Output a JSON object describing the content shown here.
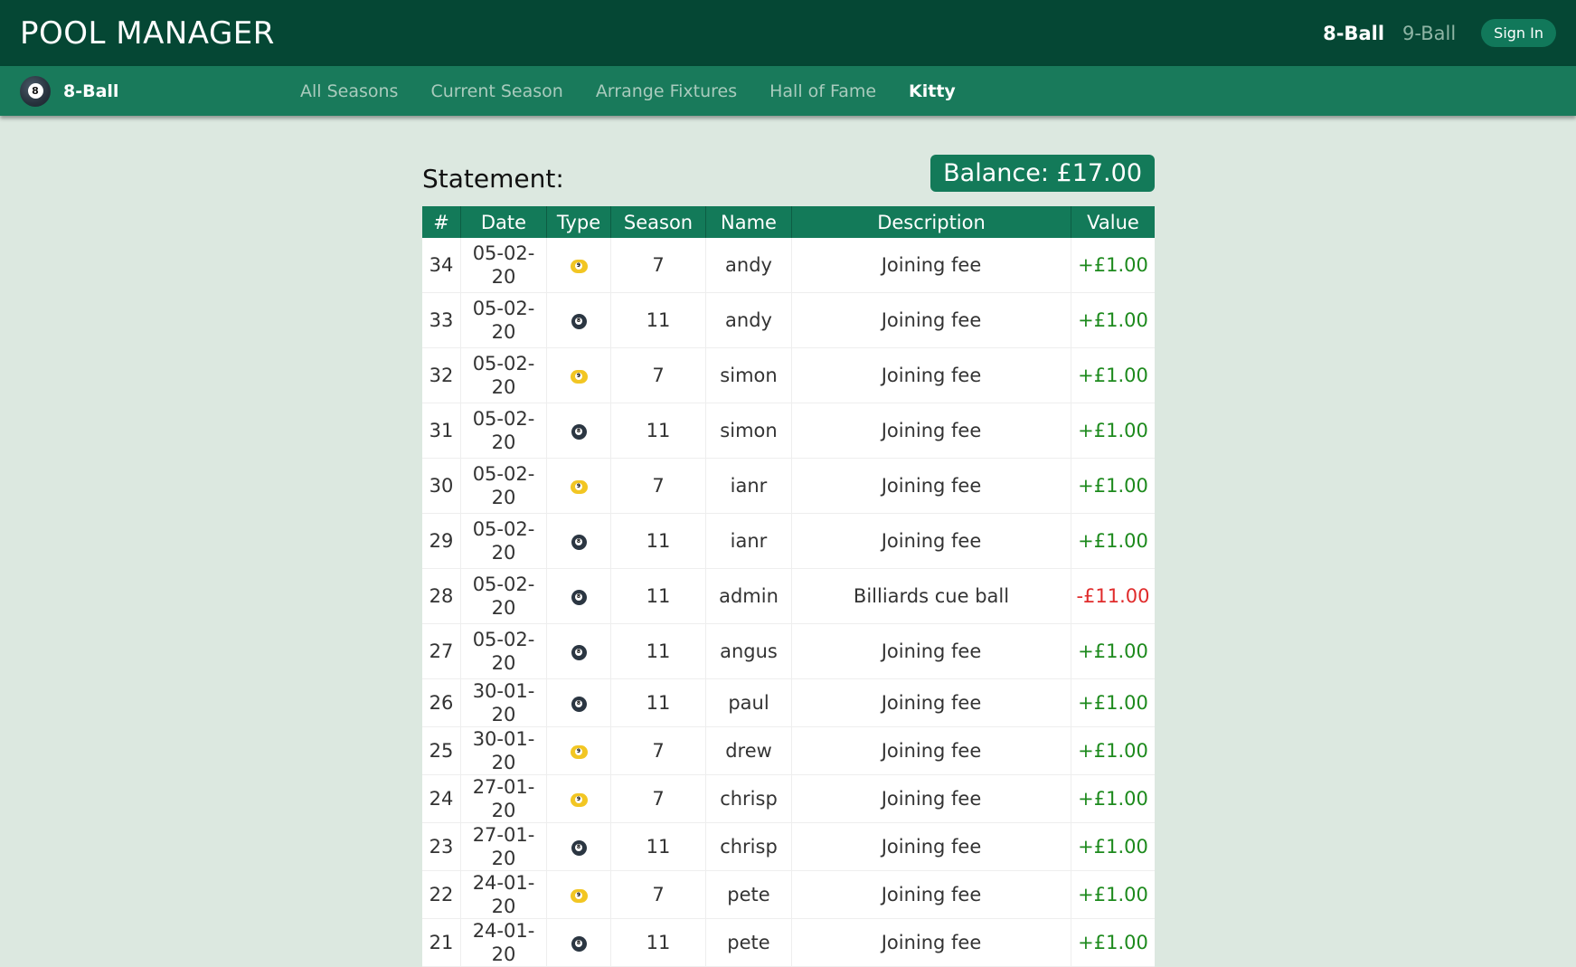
{
  "header": {
    "brand": "POOL MANAGER",
    "game_8": "8-Ball",
    "game_9": "9-Ball",
    "sign_in": "Sign In"
  },
  "subnav": {
    "title": "8-Ball",
    "ball_number": "8",
    "links": [
      "All Seasons",
      "Current Season",
      "Arrange Fixtures",
      "Hall of Fame",
      "Kitty"
    ],
    "active_link": "Kitty"
  },
  "statement": {
    "label": "Statement:",
    "balance": "Balance: £17.00"
  },
  "table": {
    "headers": [
      "#",
      "Date",
      "Type",
      "Season",
      "Name",
      "Description",
      "Value"
    ],
    "rows": [
      {
        "num": "34",
        "date": "05-02-20",
        "type": "9-ball-icon",
        "season": "7",
        "name": "andy",
        "description": "Joining fee",
        "value": "+£1.00"
      },
      {
        "num": "33",
        "date": "05-02-20",
        "type": "8-ball-icon",
        "season": "11",
        "name": "andy",
        "description": "Joining fee",
        "value": "+£1.00"
      },
      {
        "num": "32",
        "date": "05-02-20",
        "type": "9-ball-icon",
        "season": "7",
        "name": "simon",
        "description": "Joining fee",
        "value": "+£1.00"
      },
      {
        "num": "31",
        "date": "05-02-20",
        "type": "8-ball-icon",
        "season": "11",
        "name": "simon",
        "description": "Joining fee",
        "value": "+£1.00"
      },
      {
        "num": "30",
        "date": "05-02-20",
        "type": "9-ball-icon",
        "season": "7",
        "name": "ianr",
        "description": "Joining fee",
        "value": "+£1.00"
      },
      {
        "num": "29",
        "date": "05-02-20",
        "type": "8-ball-icon",
        "season": "11",
        "name": "ianr",
        "description": "Joining fee",
        "value": "+£1.00"
      },
      {
        "num": "28",
        "date": "05-02-20",
        "type": "8-ball-icon",
        "season": "11",
        "name": "admin",
        "description": "Billiards cue ball",
        "value": "-£11.00"
      },
      {
        "num": "27",
        "date": "05-02-20",
        "type": "8-ball-icon",
        "season": "11",
        "name": "angus",
        "description": "Joining fee",
        "value": "+£1.00"
      },
      {
        "num": "26",
        "date": "30-01-20",
        "type": "8-ball-icon",
        "season": "11",
        "name": "paul",
        "description": "Joining fee",
        "value": "+£1.00"
      },
      {
        "num": "25",
        "date": "30-01-20",
        "type": "9-ball-icon",
        "season": "7",
        "name": "drew",
        "description": "Joining fee",
        "value": "+£1.00"
      },
      {
        "num": "24",
        "date": "27-01-20",
        "type": "9-ball-icon",
        "season": "7",
        "name": "chrisp",
        "description": "Joining fee",
        "value": "+£1.00"
      },
      {
        "num": "23",
        "date": "27-01-20",
        "type": "8-ball-icon",
        "season": "11",
        "name": "chrisp",
        "description": "Joining fee",
        "value": "+£1.00"
      },
      {
        "num": "22",
        "date": "24-01-20",
        "type": "9-ball-icon",
        "season": "7",
        "name": "pete",
        "description": "Joining fee",
        "value": "+£1.00"
      },
      {
        "num": "21",
        "date": "24-01-20",
        "type": "8-ball-icon",
        "season": "11",
        "name": "pete",
        "description": "Joining fee",
        "value": "+£1.00"
      }
    ]
  },
  "colors": {
    "header_bg": "#054734",
    "subnav_bg": "#197a5b",
    "accent": "#137a59",
    "positive": "#1d8a1d",
    "negative": "#e02b2b",
    "page_bg": "#dce8e0"
  }
}
